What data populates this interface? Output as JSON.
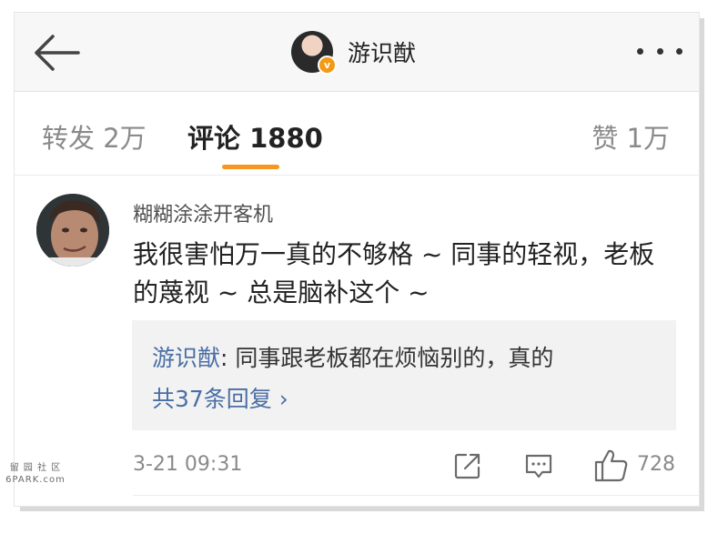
{
  "header": {
    "back_icon": "arrow-left-icon",
    "title": "游识猷",
    "verified_badge": "v",
    "more_icon": "more-dots-icon"
  },
  "tabs": [
    {
      "label": "转发 2万",
      "active": false
    },
    {
      "label": "评论 1880",
      "active": true
    },
    {
      "label": "赞 1万",
      "active": false
    }
  ],
  "accent_color": "#f79620",
  "comment": {
    "username": "糊糊涂涂开客机",
    "text": "我很害怕万一真的不够格 ~ 同事的轻视，老板的蔑视 ~ 总是脑补这个 ~",
    "reply": {
      "author": "游识猷",
      "separator": ":",
      "text": " 同事跟老板都在烦恼别的，真的",
      "more": "共37条回复 ›"
    },
    "time": "3-21 09:31",
    "actions": {
      "share_icon": "share-icon",
      "comment_icon": "comment-icon",
      "like_icon": "thumbs-up-icon",
      "like_count": "728"
    }
  },
  "watermark": {
    "line1": "留 园 社 区",
    "line2": "6PARK.com"
  }
}
